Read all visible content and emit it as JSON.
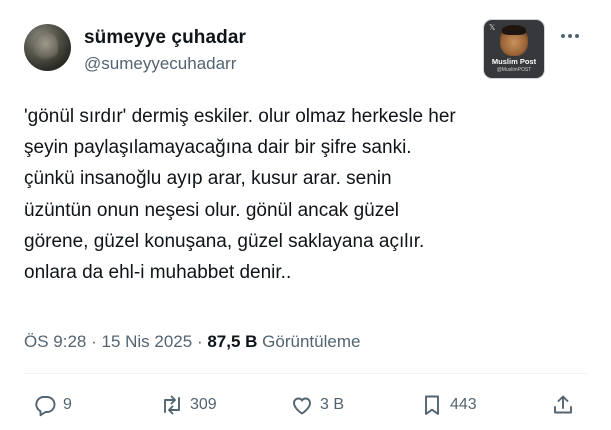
{
  "author": {
    "name": "sümeyye çuhadar",
    "handle": "@sumeyyecuhadarr"
  },
  "badge": {
    "mark": "𝕏",
    "title": "Muslim Post",
    "subtitle": "@MuslimPOST"
  },
  "tweet": {
    "lines": [
      "'gönül sırdır' dermiş eskiler. olur olmaz herkesle her",
      "şeyin paylaşılamayacağına dair bir şifre sanki.",
      "çünkü insanoğlu ayıp arar, kusur arar. senin",
      "üzüntün onun neşesi olur. gönül ancak güzel",
      "görene, güzel konuşana, güzel saklayana açılır.",
      "onlara da ehl-i muhabbet denir.."
    ]
  },
  "meta": {
    "time": "ÖS 9:28",
    "separator": " · ",
    "date": "15 Nis 2025",
    "views_count": "87,5 B",
    "views_label": "Görüntüleme"
  },
  "actions": {
    "replies": "9",
    "reposts": "309",
    "likes": "3 B",
    "bookmarks": "443"
  },
  "icons": {
    "reply": "reply-icon",
    "repost": "repost-icon",
    "like": "heart-icon",
    "bookmark": "bookmark-icon",
    "share": "share-icon",
    "more": "more-icon"
  },
  "colors": {
    "text": "#0f1419",
    "secondary": "#536471",
    "divider": "#eff3f4"
  }
}
